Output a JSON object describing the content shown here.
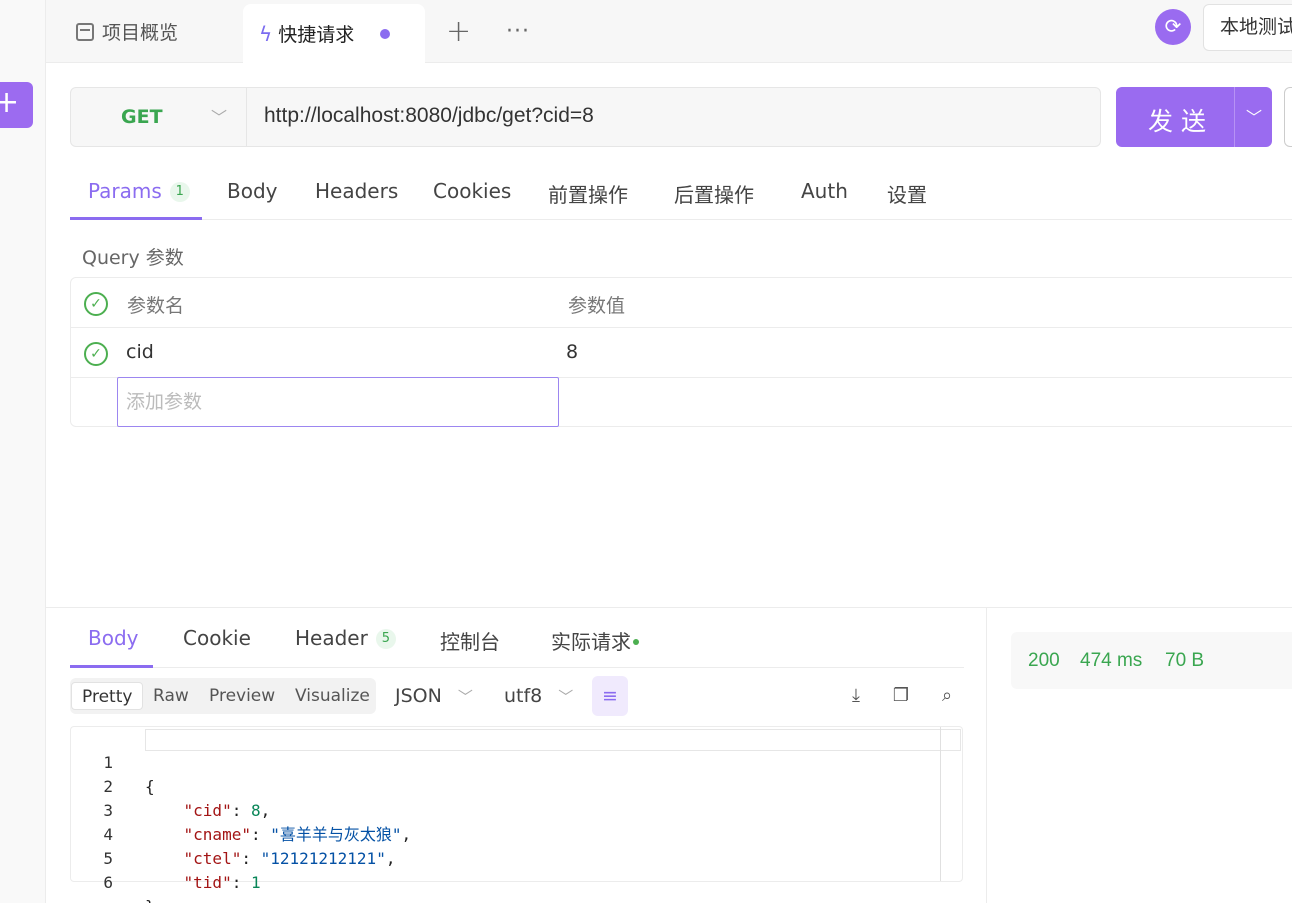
{
  "sidebar": {
    "add_button": "+"
  },
  "tabs": {
    "overview": "项目概览",
    "active": "快捷请求",
    "new": "+",
    "more": "···"
  },
  "environment": {
    "label": "本地测试"
  },
  "request": {
    "method": "GET",
    "url": "http://localhost:8080/jdbc/get?cid=8",
    "send_label": "发送"
  },
  "request_tabs": [
    {
      "label": "Params",
      "badge": "1"
    },
    {
      "label": "Body"
    },
    {
      "label": "Headers"
    },
    {
      "label": "Cookies"
    },
    {
      "label": "前置操作"
    },
    {
      "label": "后置操作"
    },
    {
      "label": "Auth"
    },
    {
      "label": "设置"
    }
  ],
  "params": {
    "section_label": "Query 参数",
    "header_name": "参数名",
    "header_value": "参数值",
    "rows": [
      {
        "name": "cid",
        "value": "8",
        "enabled": true
      }
    ],
    "add_placeholder": "添加参数"
  },
  "response_tabs": [
    {
      "label": "Body"
    },
    {
      "label": "Cookie"
    },
    {
      "label": "Header",
      "badge": "5"
    },
    {
      "label": "控制台"
    },
    {
      "label": "实际请求"
    }
  ],
  "view_modes": [
    "Pretty",
    "Raw",
    "Preview",
    "Visualize"
  ],
  "format": {
    "type": "JSON",
    "encoding": "utf8"
  },
  "code": {
    "line_numbers": [
      "1",
      "2",
      "3",
      "4",
      "5",
      "6"
    ],
    "lines": [
      "{",
      "    \"cid\": 8,",
      "    \"cname\": \"喜羊羊与灰太狼\",",
      "    \"ctel\": \"12121212121\",",
      "    \"tid\": 1",
      "}"
    ]
  },
  "status": {
    "code": "200",
    "time": "474 ms",
    "size": "70 B"
  },
  "colors": {
    "accent": "#8b6cf0",
    "success": "#3aa650"
  }
}
